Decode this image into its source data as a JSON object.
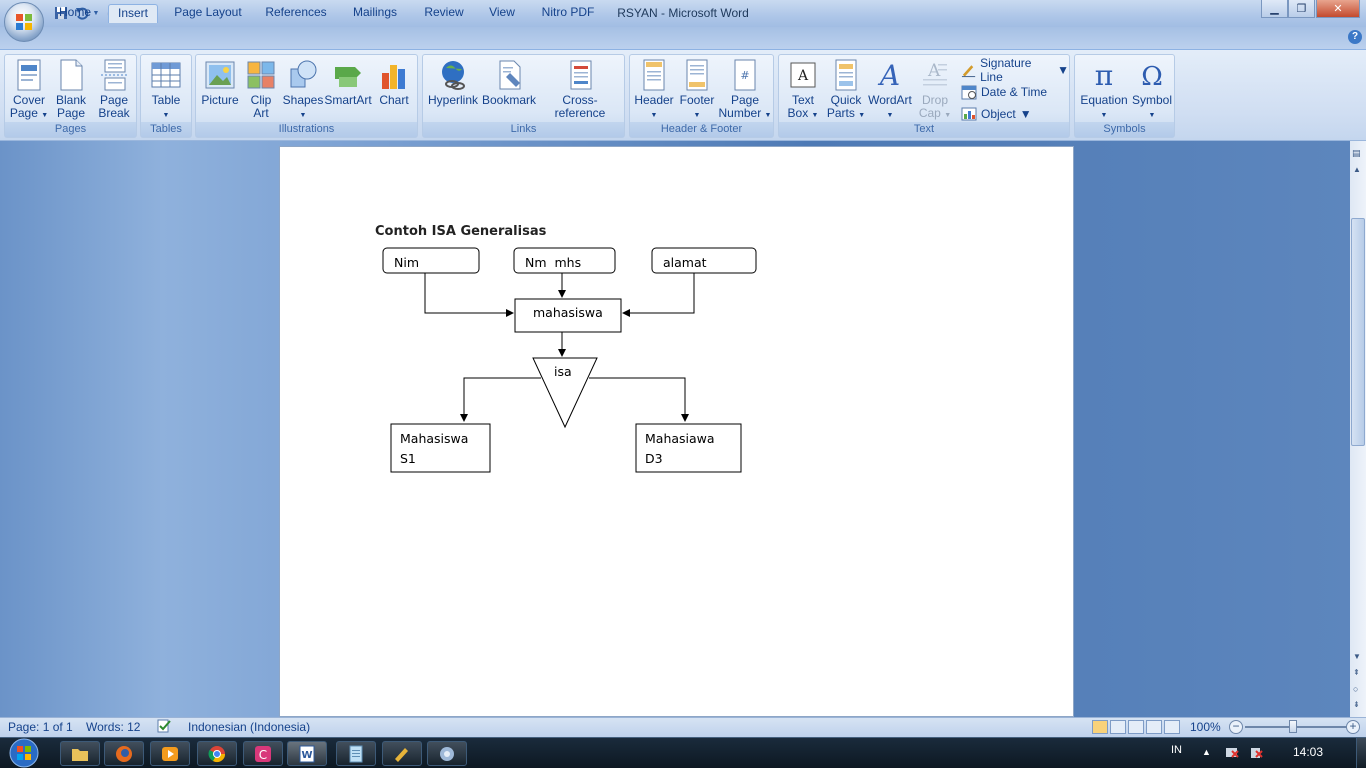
{
  "window": {
    "title": "RSYAN - Microsoft Word"
  },
  "tabs": [
    {
      "label": "Home"
    },
    {
      "label": "Insert"
    },
    {
      "label": "Page Layout"
    },
    {
      "label": "References"
    },
    {
      "label": "Mailings"
    },
    {
      "label": "Review"
    },
    {
      "label": "View"
    },
    {
      "label": "Nitro PDF"
    }
  ],
  "active_tab": "Insert",
  "ribbon": {
    "pages": {
      "label": "Pages",
      "cover_1": "Cover",
      "cover_2": "Page",
      "blank_1": "Blank",
      "blank_2": "Page",
      "break_1": "Page",
      "break_2": "Break"
    },
    "tables": {
      "label": "Tables",
      "table": "Table"
    },
    "illustrations": {
      "label": "Illustrations",
      "picture": "Picture",
      "clipart_1": "Clip",
      "clipart_2": "Art",
      "shapes": "Shapes",
      "smartart": "SmartArt",
      "chart": "Chart"
    },
    "links": {
      "label": "Links",
      "hyperlink": "Hyperlink",
      "bookmark": "Bookmark",
      "crossref": "Cross-reference"
    },
    "header_footer": {
      "label": "Header & Footer",
      "header": "Header",
      "footer": "Footer",
      "pagenum_1": "Page",
      "pagenum_2": "Number"
    },
    "text": {
      "label": "Text",
      "textbox_1": "Text",
      "textbox_2": "Box",
      "quickparts_1": "Quick",
      "quickparts_2": "Parts",
      "wordart": "WordArt",
      "dropcap_1": "Drop",
      "dropcap_2": "Cap",
      "signature": "Signature Line",
      "datetime": "Date & Time",
      "object": "Object"
    },
    "symbols": {
      "label": "Symbols",
      "equation": "Equation",
      "symbol": "Symbol"
    }
  },
  "document": {
    "heading": "Contoh ISA Generalisas",
    "attr_nim": "Nim",
    "attr_nm_mhs": "Nm  mhs",
    "attr_alamat": "alamat",
    "entity": "mahasiswa",
    "isa": "isa",
    "sub1_line1": "Mahasiswa",
    "sub1_line2": "S1",
    "sub2_line1": "Mahasiawa",
    "sub2_line2": "D3"
  },
  "statusbar": {
    "page": "Page: 1 of 1",
    "words": "Words: 12",
    "language": "Indonesian (Indonesia)",
    "zoom": "100%"
  },
  "taskbar": {
    "lang": "IN",
    "clock": "14:03"
  },
  "colors": {
    "ribbon_bg": "#dbe7f6",
    "workspace": "#5d86bd",
    "taskbar": "#0d1822"
  }
}
